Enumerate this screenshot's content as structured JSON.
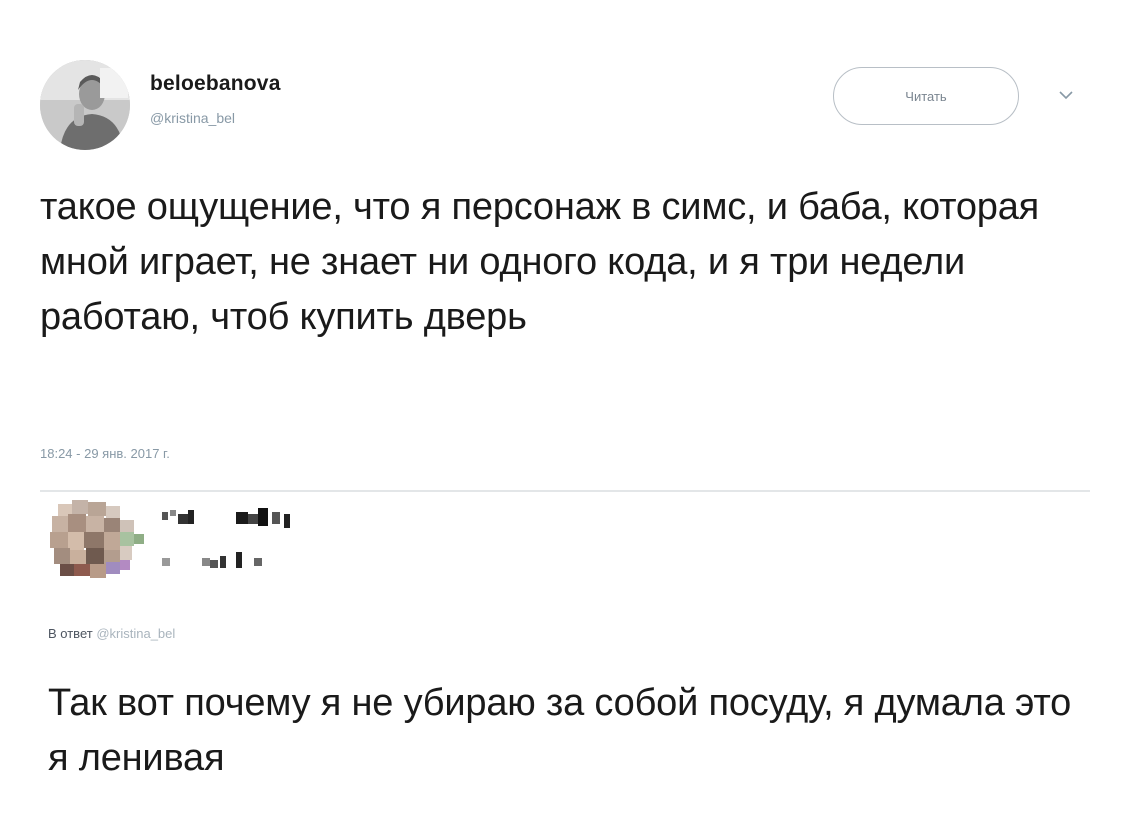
{
  "tweet": {
    "author": {
      "display_name": "beloebanova",
      "handle": "@kristina_bel",
      "avatar_icon": "user-avatar-photo"
    },
    "follow_button_label": "Читать",
    "menu_icon": "chevron-down-icon",
    "text": "такое ощущение, что я персонаж в симс, и баба, которая мной играет, не знает ни одного кода, и я три недели работаю, чтоб купить дверь",
    "timestamp": "18:24 - 29 янв. 2017 г."
  },
  "reply": {
    "author": {
      "avatar_icon": "pixelated-avatar"
    },
    "context_label": "В ответ",
    "context_mention": "@kristina_bel",
    "text": "Так вот почему я не убираю за собой посуду, я думала это я ленивая"
  },
  "colors": {
    "text": "#1a1a1a",
    "muted": "#8899a6",
    "divider": "#e3e6e8",
    "button_border": "#b8bfc6"
  }
}
